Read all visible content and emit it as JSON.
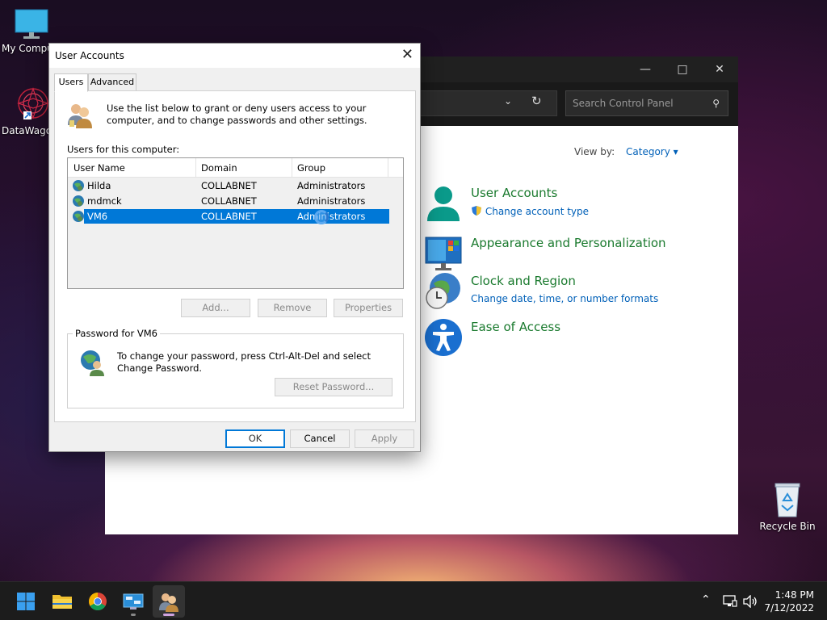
{
  "desktop": {
    "icons": [
      {
        "label": "My Compu"
      },
      {
        "label": "DataWagor"
      },
      {
        "label": "Recycle Bin"
      }
    ]
  },
  "control_panel": {
    "search_placeholder": "Search Control Panel",
    "view_by_label": "View by:",
    "view_by_value": "Category",
    "categories": [
      {
        "title": "User Accounts",
        "sub": "Change account type"
      },
      {
        "title": "Appearance and Personalization",
        "sub": ""
      },
      {
        "title": "Clock and Region",
        "sub": "Change date, time, or number formats"
      },
      {
        "title": "Ease of Access",
        "sub": ""
      }
    ]
  },
  "dialog": {
    "title": "User Accounts",
    "tabs": [
      {
        "label": "Users"
      },
      {
        "label": "Advanced"
      }
    ],
    "intro": "Use the list below to grant or deny users access to your computer, and to change passwords and other settings.",
    "users_label": "Users for this computer:",
    "columns": [
      "User Name",
      "Domain",
      "Group"
    ],
    "rows": [
      {
        "name": "Hilda",
        "domain": "COLLABNET",
        "group": "Administrators"
      },
      {
        "name": "mdmck",
        "domain": "COLLABNET",
        "group": "Administrators"
      },
      {
        "name": "VM6",
        "domain": "COLLABNET",
        "group": "Administrators"
      }
    ],
    "selected_row": 2,
    "buttons": {
      "add": "Add...",
      "remove": "Remove",
      "properties": "Properties"
    },
    "password_group_label": "Password for VM6",
    "password_text": "To change your password, press Ctrl-Alt-Del and select Change Password.",
    "reset_password": "Reset Password...",
    "ok": "OK",
    "cancel": "Cancel",
    "apply": "Apply"
  },
  "taskbar": {
    "time": "1:48 PM",
    "date": "7/12/2022"
  },
  "colors": {
    "accent": "#0078d7",
    "category_title": "#1a7a2e",
    "link": "#0060b8"
  }
}
